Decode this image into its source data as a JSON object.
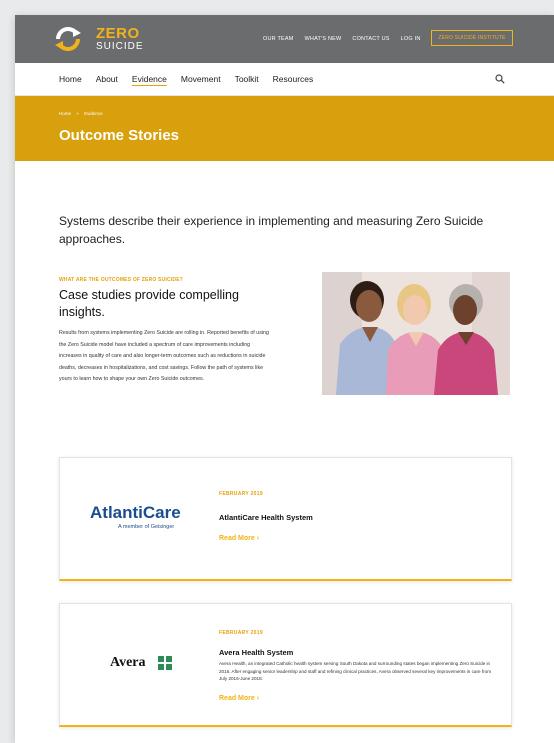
{
  "brand": {
    "word1": "ZERO",
    "word2": "SUICIDE",
    "accent": "#f2b319",
    "dark": "#6b6c6e",
    "hero_bg": "#d9a00e"
  },
  "top_links": [
    "OUR TEAM",
    "WHAT'S NEW",
    "CONTACT US",
    "LOG IN"
  ],
  "top_button": "ZERO SUICIDE INSTITUTE",
  "nav": {
    "items": [
      "Home",
      "About",
      "Evidence",
      "Movement",
      "Toolkit",
      "Resources"
    ],
    "active": "Evidence",
    "search_icon": "search-icon"
  },
  "hero": {
    "breadcrumb": [
      "Home",
      "»",
      "Evidence"
    ],
    "title": "Outcome Stories"
  },
  "intro": "Systems describe their experience in implementing and measuring Zero Suicide approaches.",
  "section": {
    "eyebrow": "WHAT ARE THE OUTCOMES OF ZERO SUICIDE?",
    "title": "Case studies provide compelling insights.",
    "body": "Results from systems implementing Zero Suicide are rolling in. Reported benefits of using the Zero Suicide model have included a spectrum of care improvements including increases in quality of care and also longer-term outcomes such as reductions in suicide deaths, decreases in hospitalizations, and cost savings. Follow the path of systems like yours to learn how to shape your own Zero Suicide outcomes."
  },
  "cards": [
    {
      "logo_text": "AtlantiCare",
      "logo_sub": "A member of Geisinger",
      "date": "FEBRUARY 2019",
      "title": "AtlantiCare Health System",
      "desc": "",
      "more": "Read More ›"
    },
    {
      "logo_text": "Avera",
      "logo_sub": "",
      "date": "FEBRUARY 2019",
      "title": "Avera Health System",
      "desc": "Avera Health, an integrated Catholic health system serving South Dakota and surrounding states began implementing Zero Suicide in 2016. After engaging senior leadership and staff and refining clinical practices, Avera observed several key improvements in care from July 2016-June 2018.",
      "more": "Read More ›"
    }
  ]
}
